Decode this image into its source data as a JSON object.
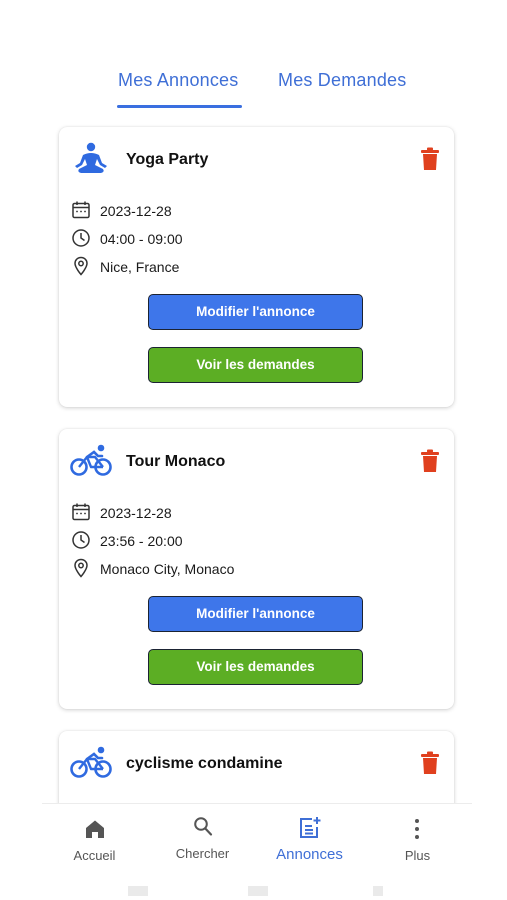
{
  "tabs": [
    {
      "label": "Mes Annonces",
      "active": true
    },
    {
      "label": "Mes Demandes",
      "active": false
    }
  ],
  "colors": {
    "accent": "#3f6fd6",
    "edit_button": "#3e76ea",
    "view_button": "#5cae24",
    "delete": "#e0401e",
    "activity_icon": "#2f6ae0"
  },
  "annonces": [
    {
      "icon": "yoga-icon",
      "title": "Yoga Party",
      "date": "2023-12-28",
      "time": "04:00 - 09:00",
      "location": "Nice, France",
      "edit_label": "Modifier l'annonce",
      "view_label": "Voir les demandes"
    },
    {
      "icon": "bicycle-icon",
      "title": "Tour Monaco",
      "date": "2023-12-28",
      "time": "23:56 - 20:00",
      "location": "Monaco City, Monaco",
      "edit_label": "Modifier l'annonce",
      "view_label": "Voir les demandes"
    },
    {
      "icon": "bicycle-icon",
      "title": "cyclisme condamine"
    }
  ],
  "nav": [
    {
      "label": "Accueil",
      "icon": "home-icon",
      "active": false
    },
    {
      "label": "Chercher",
      "icon": "search-icon",
      "active": false
    },
    {
      "label": "Annonces",
      "icon": "post-add-icon",
      "active": true
    },
    {
      "label": "Plus",
      "icon": "more-vertical-icon",
      "active": false
    }
  ]
}
